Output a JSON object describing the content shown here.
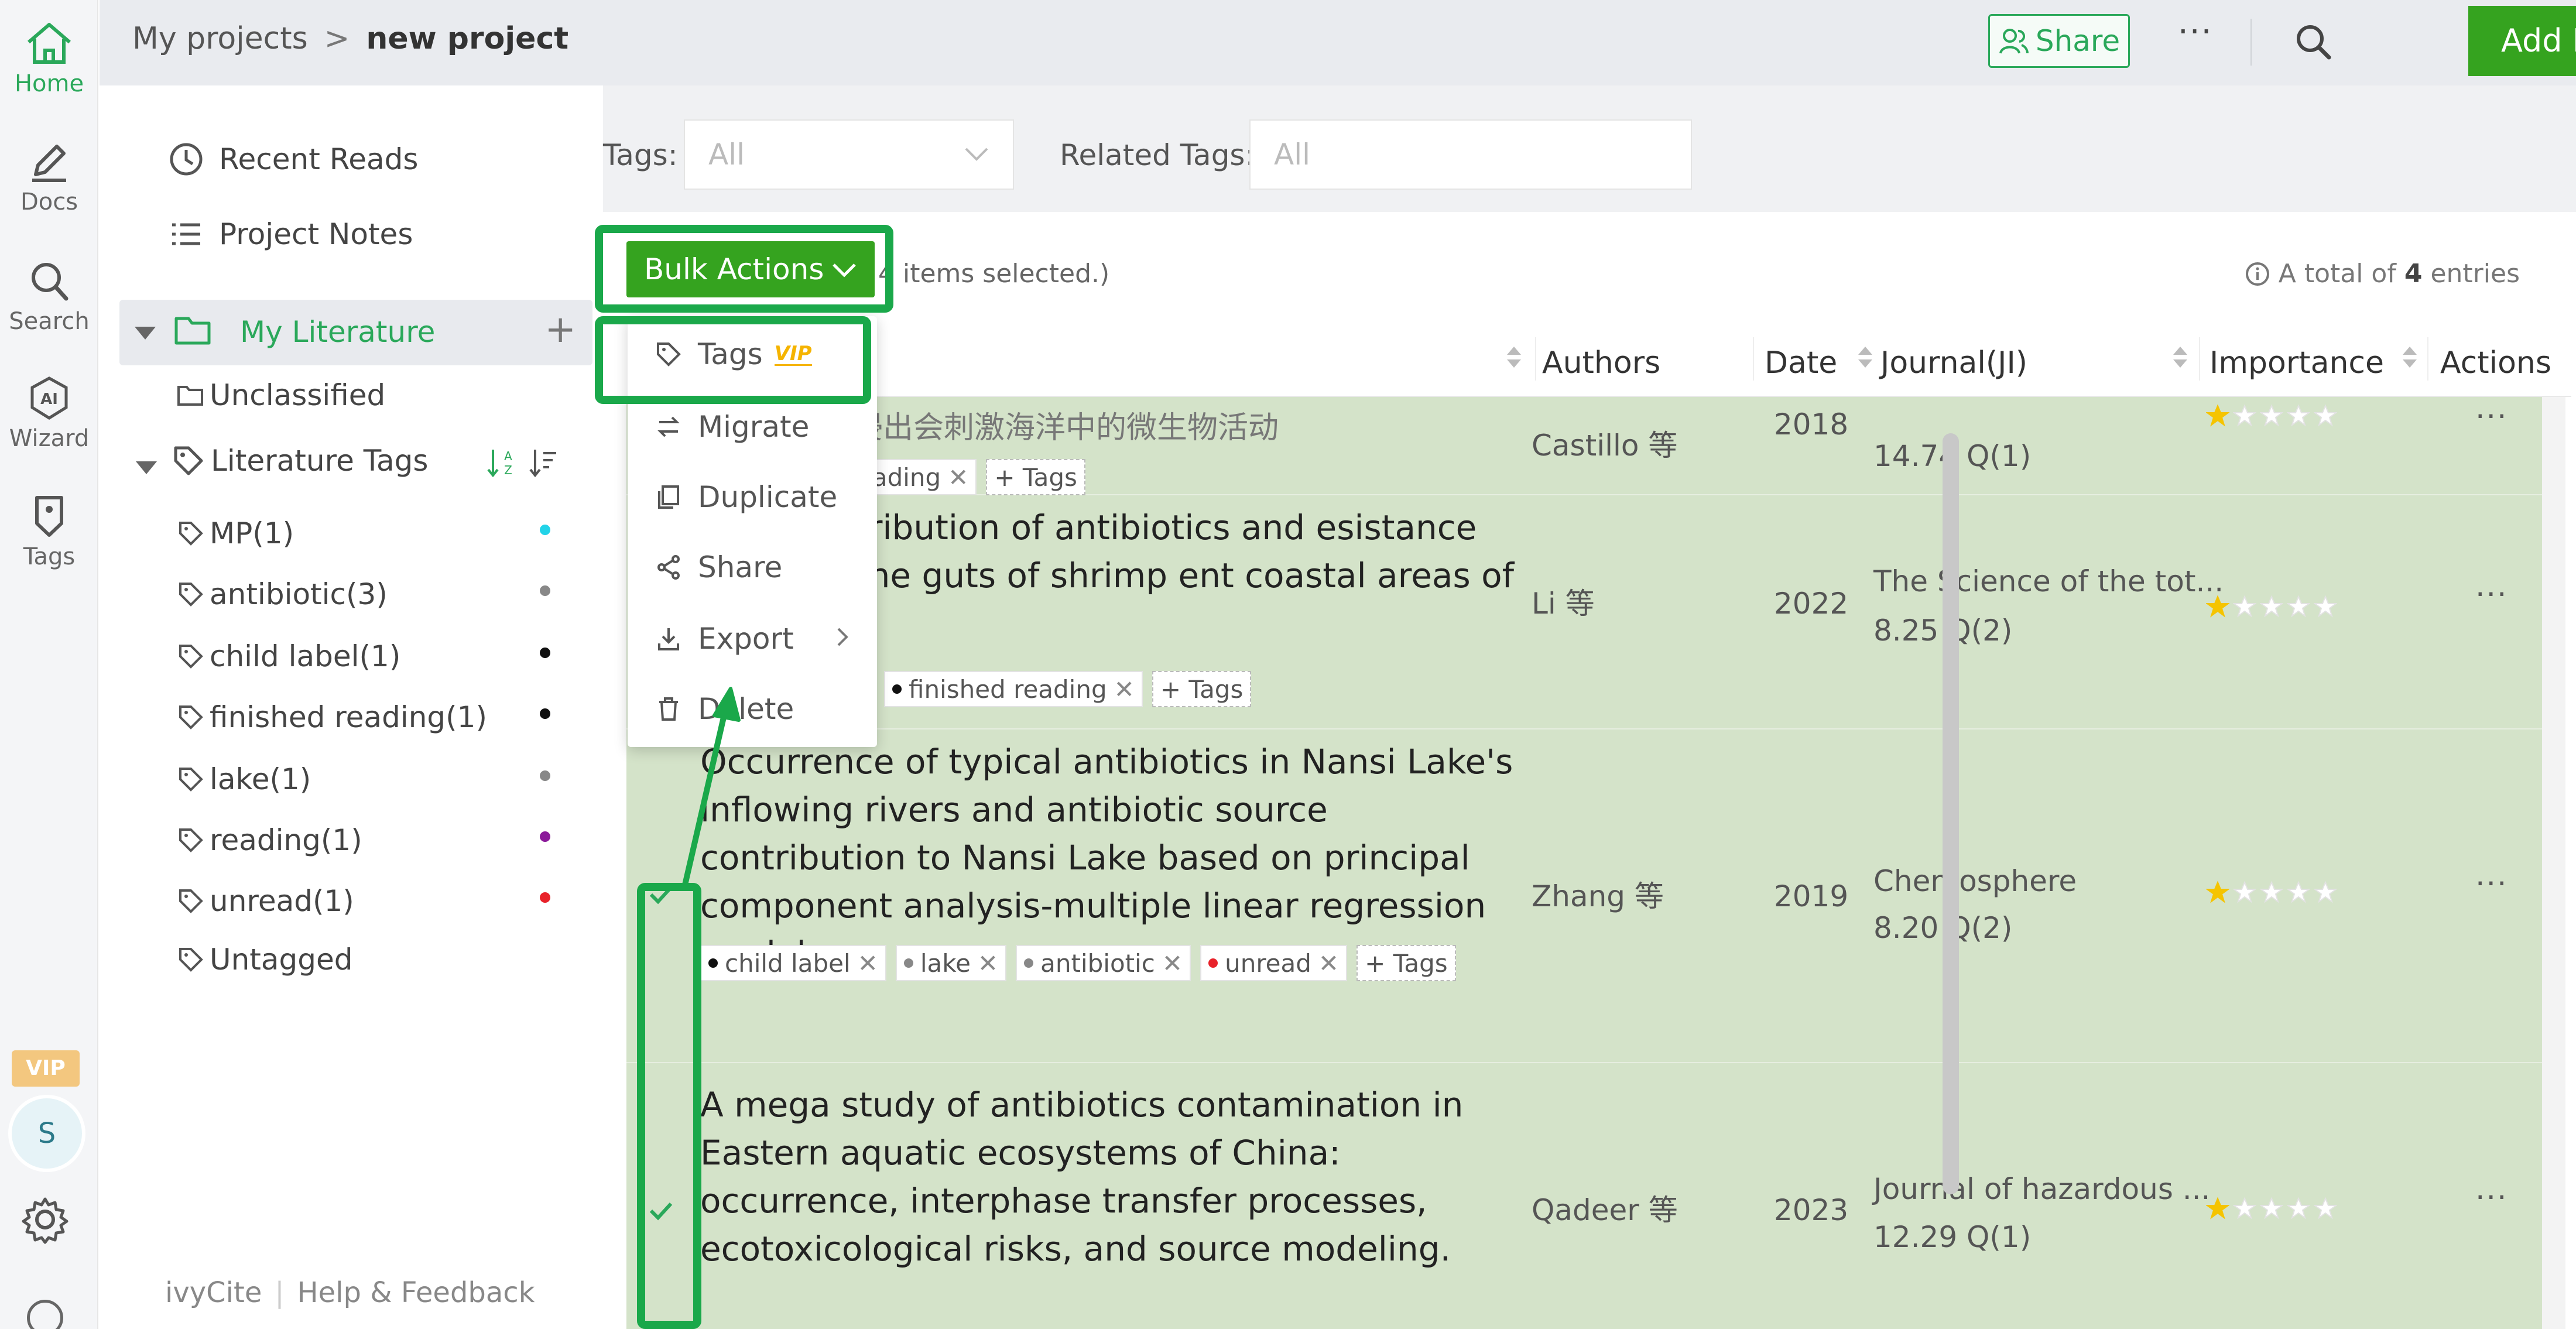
{
  "rail": {
    "items": [
      {
        "label": "Home",
        "icon": "home-icon"
      },
      {
        "label": "Docs",
        "icon": "pen-icon"
      },
      {
        "label": "Search",
        "icon": "search-icon"
      },
      {
        "label": "Wizard",
        "icon": "ai-wizard-icon"
      },
      {
        "label": "Tags",
        "icon": "tag-icon"
      }
    ],
    "vip": "VIP",
    "avatar": "S"
  },
  "header": {
    "breadcrumb_root": "My projects",
    "breadcrumb_sep": ">",
    "breadcrumb_current": "new project",
    "share_label": "Share",
    "more_label": "···",
    "add_paper_label": "Add Paper"
  },
  "sidebar": {
    "recent_reads": "Recent Reads",
    "project_notes": "Project Notes",
    "my_literature": "My Literature",
    "unclassified": "Unclassified",
    "literature_tags": "Literature Tags",
    "tags": [
      {
        "label": "MP(1)",
        "color": "#22d3e8"
      },
      {
        "label": "antibiotic(3)",
        "color": "#888888"
      },
      {
        "label": "child label(1)",
        "color": "#111111"
      },
      {
        "label": "finished reading(1)",
        "color": "#111111"
      },
      {
        "label": "lake(1)",
        "color": "#888888"
      },
      {
        "label": "reading(1)",
        "color": "#8b1a9a"
      },
      {
        "label": "unread(1)",
        "color": "#e8222a"
      }
    ],
    "untagged": "Untagged",
    "footer_brand": "ivyCite",
    "footer_sep": "|",
    "footer_help": "Help & Feedback"
  },
  "filters": {
    "tags_label": "Tags:",
    "tags_value": "All",
    "related_label": "Related Tags:",
    "related_value": "All"
  },
  "toolbar": {
    "bulk_actions": "Bulk Actions",
    "selected_text": "4 items selected.)",
    "total_prefix": "A total of",
    "total_count": "4",
    "total_suffix": "entries"
  },
  "table": {
    "columns": {
      "authors": "Authors",
      "date": "Date",
      "journal": "Journal(JI)",
      "importance": "Importance",
      "actions": "Actions"
    },
    "rows": [
      {
        "title": "解的有机碳浸出会刺激海洋中的微生物活动",
        "authors": "Castillo 等",
        "date": "2018",
        "journal": "",
        "impact": "14.74 Q(1)",
        "tags": [
          {
            "label": "eading"
          }
        ],
        "add_tag": "+ Tags",
        "importance": 1
      },
      {
        "title": "e and distribution of antibiotics and esistance genes in the guts of shrimp ent coastal areas of China.",
        "authors": "Li 等",
        "date": "2022",
        "journal": "The Science of the tot...",
        "impact": "8.25 Q(2)",
        "tags": [
          {
            "label": "finished reading",
            "color": "#111111"
          }
        ],
        "add_tag": "+ Tags",
        "importance": 1
      },
      {
        "title": "Occurrence of typical antibiotics in Nansi Lake's inflowing rivers and antibiotic source contribution to Nansi Lake based on principal component analysis-multiple linear regression model",
        "authors": "Zhang 等",
        "date": "2019",
        "journal": "Chemosphere",
        "impact": "8.20 Q(2)",
        "tags": [
          {
            "label": "child label",
            "color": "#111111"
          },
          {
            "label": "lake",
            "color": "#888888"
          },
          {
            "label": "antibiotic",
            "color": "#888888"
          },
          {
            "label": "unread",
            "color": "#e8222a"
          }
        ],
        "add_tag": "+ Tags",
        "importance": 1
      },
      {
        "title": "A mega study of antibiotics contamination in Eastern aquatic ecosystems of China: occurrence, interphase transfer processes, ecotoxicological risks, and source modeling.",
        "authors": "Qadeer 等",
        "date": "2023",
        "journal": "Journal of hazardous ...",
        "impact": "12.29 Q(1)",
        "tags": [],
        "add_tag": "",
        "importance": 1
      }
    ]
  },
  "dropdown": {
    "items": [
      {
        "label": "Tags",
        "icon": "tag-icon",
        "vip": "VIP"
      },
      {
        "label": "Migrate",
        "icon": "migrate-icon"
      },
      {
        "label": "Duplicate",
        "icon": "duplicate-icon"
      },
      {
        "label": "Share",
        "icon": "share-icon"
      },
      {
        "label": "Export",
        "icon": "export-icon"
      },
      {
        "label": "Delete",
        "icon": "trash-icon"
      }
    ]
  },
  "colors": {
    "brand_green": "#35a31f",
    "accent_green": "#2aa85a",
    "highlight_green": "#1aa84a",
    "selected_row_bg": "#d4e3c9",
    "journal_orange": "#f3a52a"
  }
}
